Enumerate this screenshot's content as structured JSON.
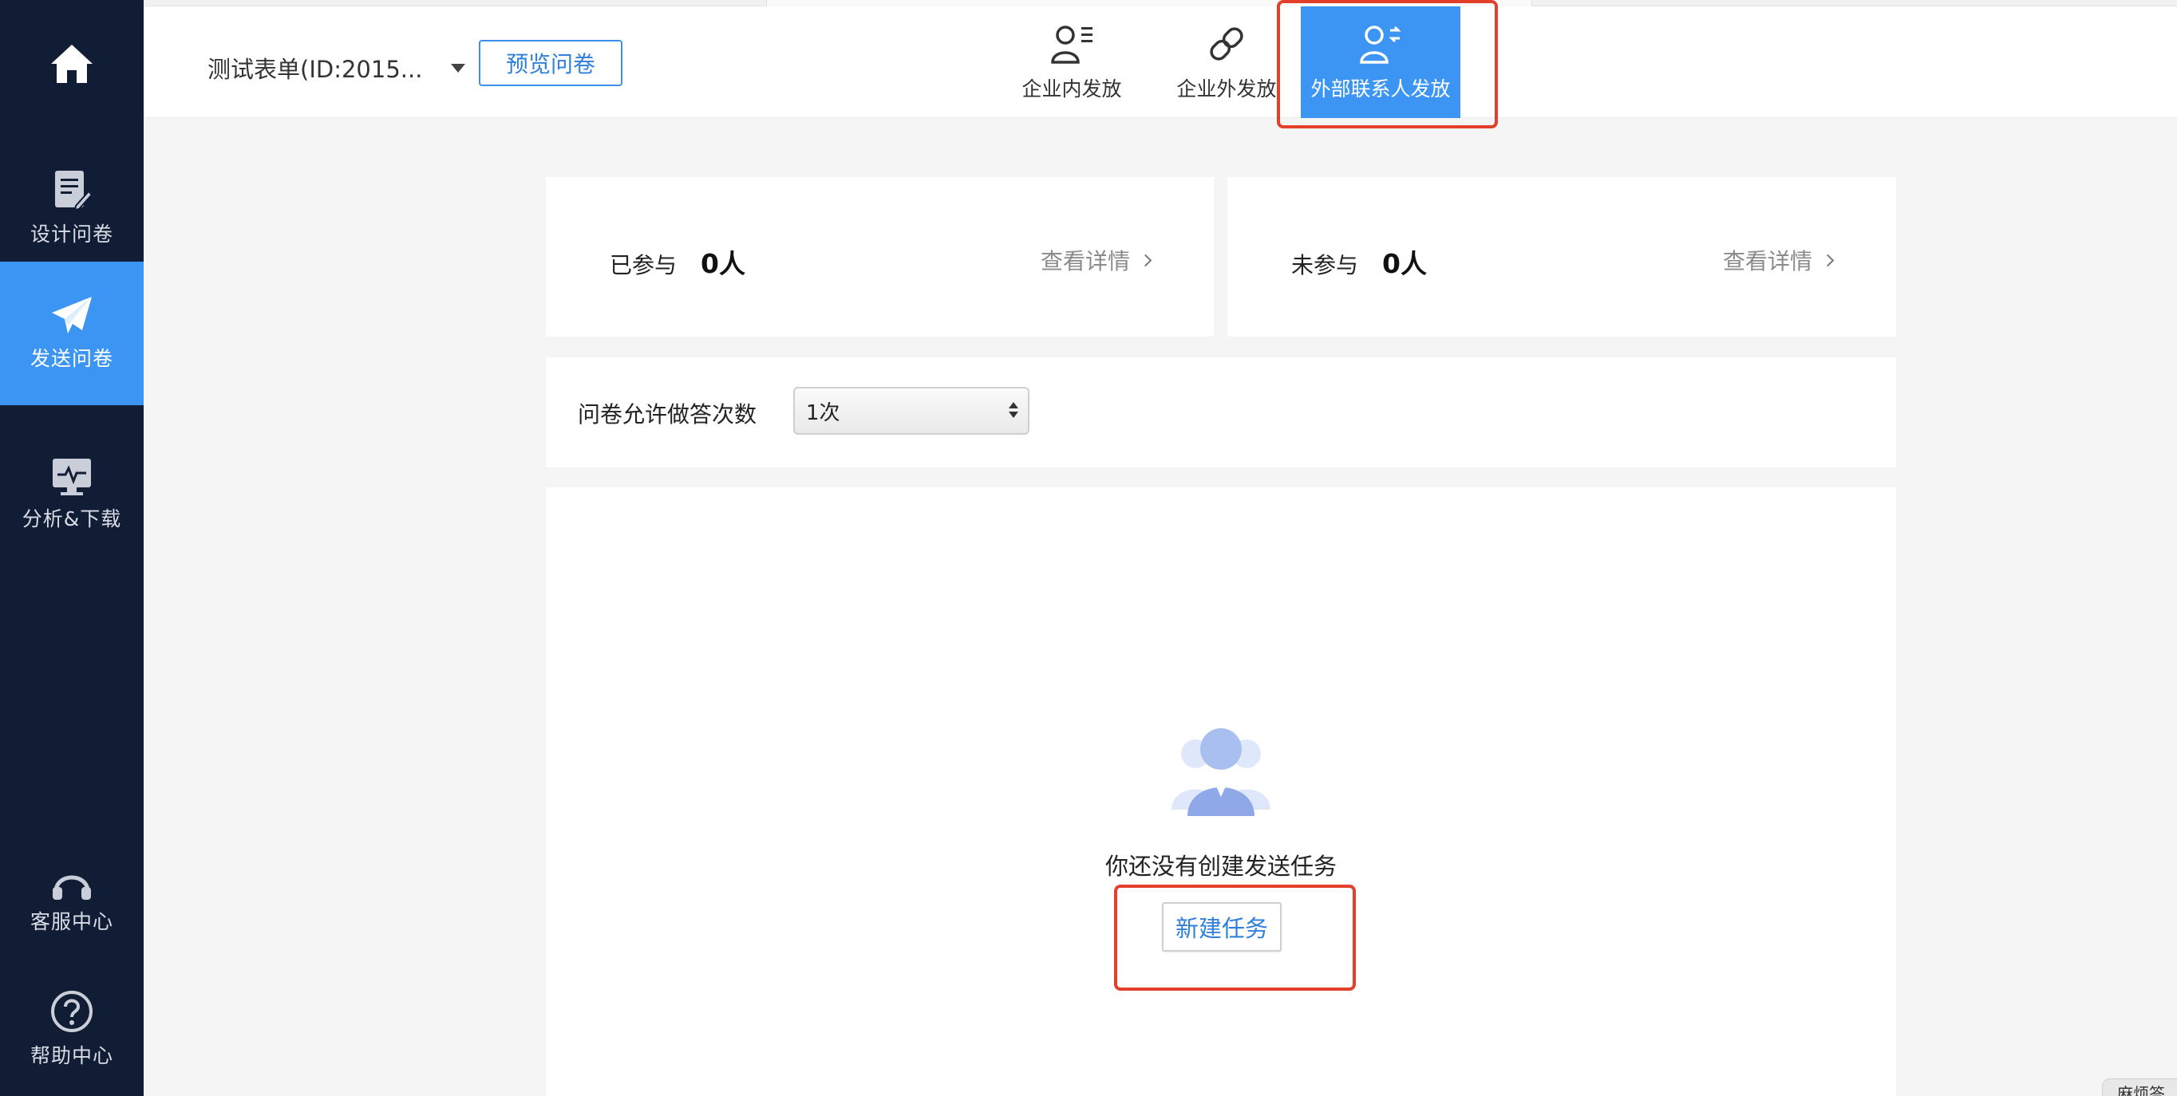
{
  "sidebar": {
    "items": [
      {
        "label": "设计问卷",
        "icon": "design-survey-icon"
      },
      {
        "label": "发送问卷",
        "icon": "send-paper-plane-icon",
        "active": true
      },
      {
        "label": "分析&下载",
        "icon": "analysis-monitor-icon"
      },
      {
        "label": "客服中心",
        "icon": "headset-icon"
      },
      {
        "label": "帮助中心",
        "icon": "question-circle-icon"
      }
    ]
  },
  "header": {
    "form_name": "测试表单(ID:2015...",
    "preview_label": "预览问卷",
    "tabs": [
      {
        "label": "企业内发放",
        "icon": "internal-user-list-icon"
      },
      {
        "label": "企业外发放",
        "icon": "link-icon"
      },
      {
        "label": "外部联系人发放",
        "icon": "external-contact-icon",
        "active": true
      }
    ]
  },
  "stats": {
    "joined": {
      "label": "已参与",
      "value": "0人",
      "detail": "查看详情"
    },
    "not_joined": {
      "label": "未参与",
      "value": "0人",
      "detail": "查看详情"
    }
  },
  "attempts": {
    "label": "问卷允许做答次数",
    "selected": "1次"
  },
  "tasks": {
    "empty_text": "你还没有创建发送任务",
    "new_task_label": "新建任务"
  },
  "corner_chip": {
    "label": "麻烦答"
  },
  "colors": {
    "sidebar_bg": "#111c35",
    "accent": "#3d95f3",
    "highlight": "#e2402a"
  }
}
